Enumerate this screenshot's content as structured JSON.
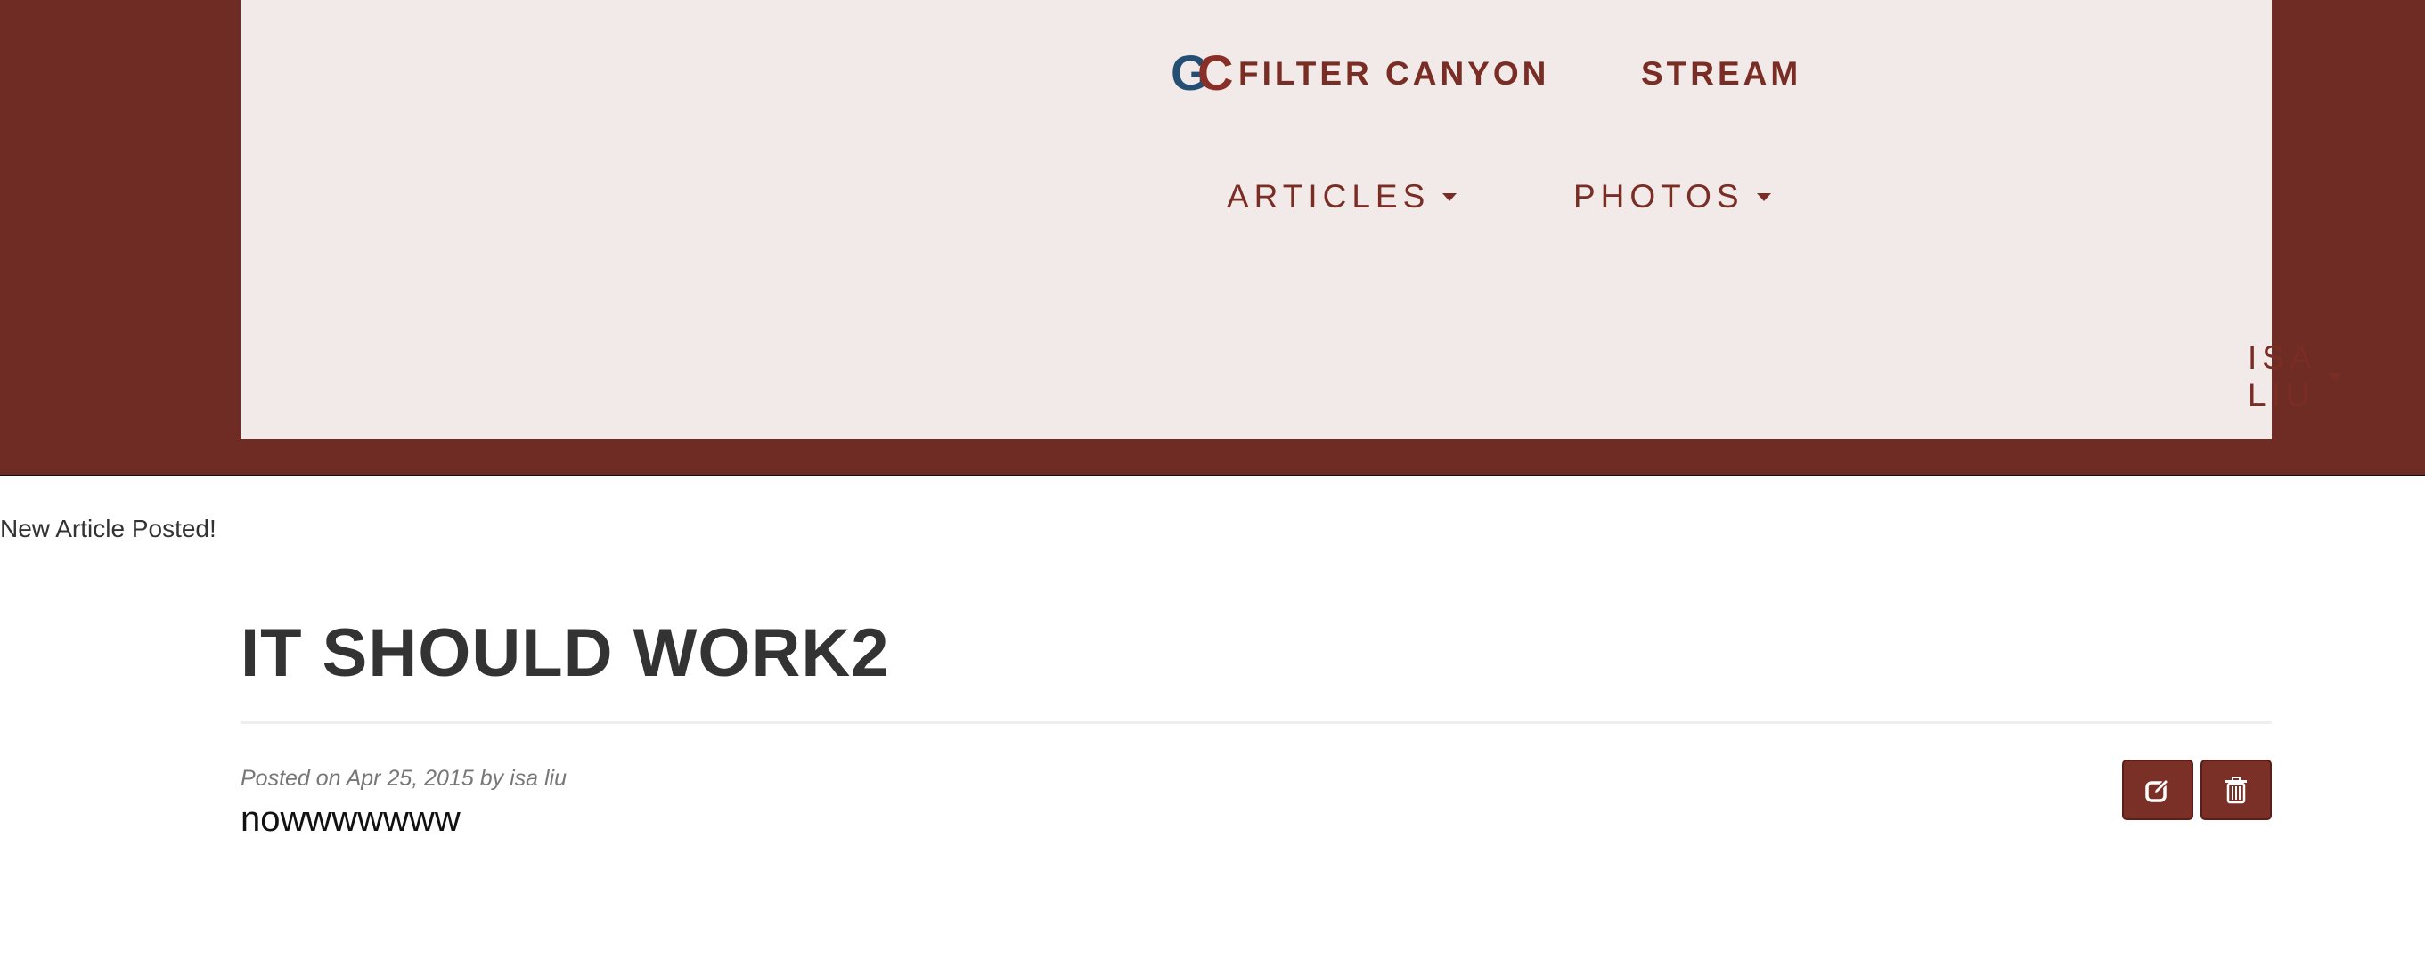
{
  "header": {
    "brand_logo": "GC",
    "brand_name": "FILTER CANYON",
    "stream_label": "STREAM",
    "articles_label": "ARTICLES",
    "photos_label": "PHOTOS",
    "user_label": "ISA LIU"
  },
  "flash": {
    "message": "New Article Posted!"
  },
  "article": {
    "title": "IT SHOULD WORK2",
    "meta": "Posted on Apr 25, 2015 by isa liu",
    "body": "nowwwwwww"
  },
  "actions": {
    "edit_icon": "edit-icon",
    "delete_icon": "trash-icon"
  },
  "colors": {
    "brand": "#6e2c24",
    "panel": "#f1eae8",
    "logo_blue": "#244e72",
    "logo_red": "#8a2f28",
    "button": "#7a2f27"
  }
}
